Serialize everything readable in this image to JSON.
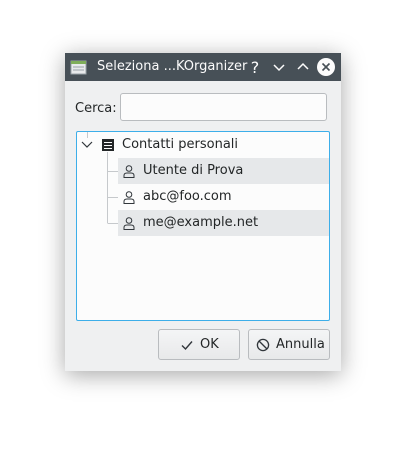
{
  "window": {
    "title": "Seleziona ...KOrganizer"
  },
  "search": {
    "label": "Cerca:",
    "value": "",
    "placeholder": ""
  },
  "tree": {
    "root": {
      "label": "Contatti personali",
      "icon": "address-book-icon",
      "expanded": true
    },
    "children": [
      {
        "label": "Utente di Prova",
        "icon": "person-icon"
      },
      {
        "label": "abc@foo.com",
        "icon": "person-icon"
      },
      {
        "label": "me@example.net",
        "icon": "person-icon"
      }
    ]
  },
  "buttons": {
    "ok_label": "OK",
    "cancel_label": "Annulla"
  },
  "colors": {
    "titlebar": "#475057",
    "focus_border": "#3daee9",
    "window_bg": "#eff0f1",
    "alt_row": "#e6e8ea"
  }
}
